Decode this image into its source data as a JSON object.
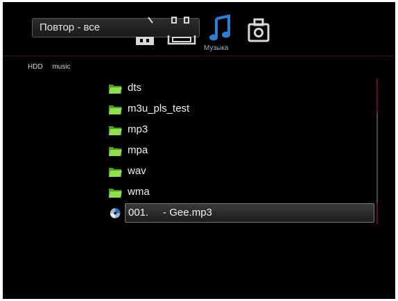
{
  "repeat": {
    "label": "Повтор - все"
  },
  "modes": {
    "icons": [
      "video-icon",
      "film-icon",
      "music-note-icon",
      "camera-icon"
    ],
    "active_label": "Музыка"
  },
  "path": [
    "HDD",
    "music"
  ],
  "items": [
    {
      "type": "folder",
      "label": "dts"
    },
    {
      "type": "folder",
      "label": "m3u_pls_test"
    },
    {
      "type": "folder",
      "label": "mp3"
    },
    {
      "type": "folder",
      "label": "mpa"
    },
    {
      "type": "folder",
      "label": "wav"
    },
    {
      "type": "folder",
      "label": "wma"
    },
    {
      "type": "audio",
      "label": "001.     - Gee.mp3",
      "selected": true
    }
  ],
  "colors": {
    "folder": "#7dd63a",
    "accent": "#2a7fd6",
    "scroll_thumb": "#6b1010"
  }
}
